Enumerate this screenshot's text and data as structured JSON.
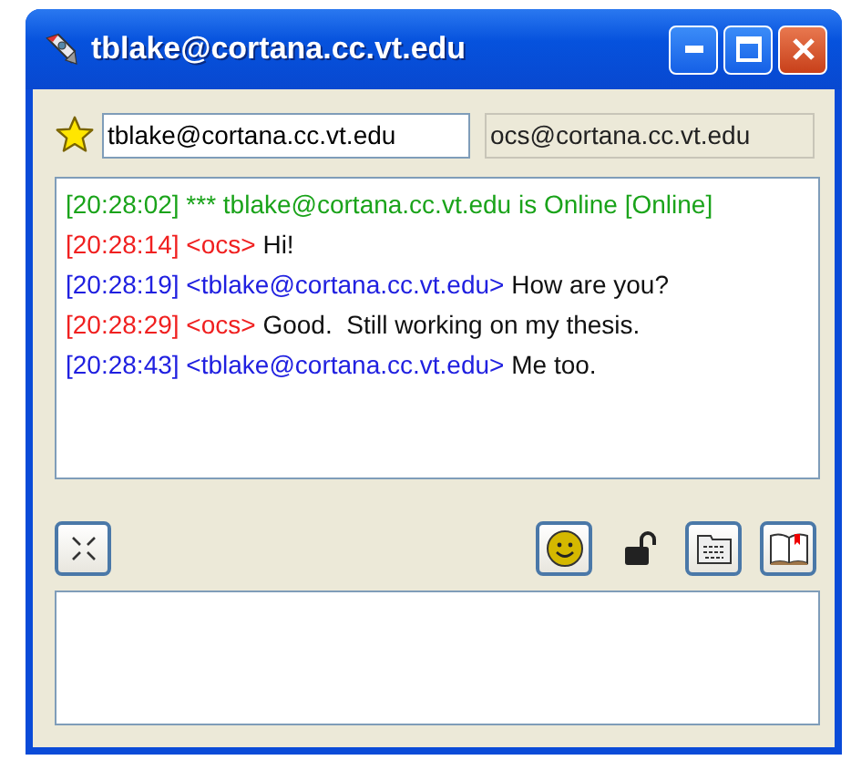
{
  "window": {
    "title": "tblake@cortana.cc.vt.edu"
  },
  "contacts": {
    "local": "tblake@cortana.cc.vt.edu",
    "remote": "ocs@cortana.cc.vt.edu"
  },
  "messages": [
    {
      "kind": "status",
      "time": "[20:28:02]",
      "text": "*** tblake@cortana.cc.vt.edu is Online [Online]"
    },
    {
      "kind": "incoming",
      "time": "[20:28:14]",
      "sender": "<ocs>",
      "text": "Hi!"
    },
    {
      "kind": "outgoing",
      "time": "[20:28:19]",
      "sender": "<tblake@cortana.cc.vt.edu>",
      "text": "How are you?"
    },
    {
      "kind": "incoming",
      "time": "[20:28:29]",
      "sender": "<ocs>",
      "text": "Good.  Still working on my thesis."
    },
    {
      "kind": "outgoing",
      "time": "[20:28:43]",
      "sender": "<tblake@cortana.cc.vt.edu>",
      "text": "Me too."
    }
  ],
  "toolbar": [
    {
      "kind": "smiley",
      "active": true
    },
    {
      "kind": "lock",
      "active": false
    },
    {
      "kind": "keyboard",
      "active": true
    },
    {
      "kind": "book",
      "active": true
    }
  ]
}
